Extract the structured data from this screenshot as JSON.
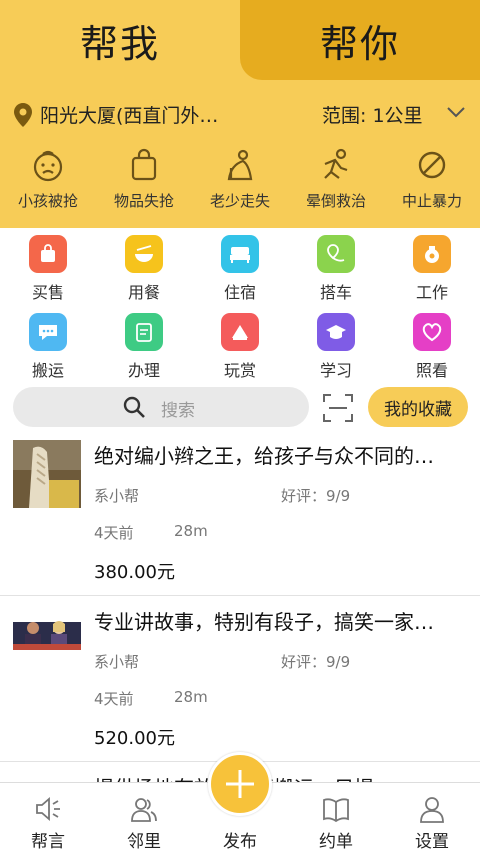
{
  "tabs": {
    "left": "帮我",
    "right": "帮你"
  },
  "location": {
    "address": "阳光大厦(西直门外…",
    "range": "范围: 1公里"
  },
  "quick_actions": [
    {
      "label": "小孩被抢",
      "icon": "baby-face-icon"
    },
    {
      "label": "物品失抢",
      "icon": "bag-icon"
    },
    {
      "label": "老少走失",
      "icon": "walker-icon"
    },
    {
      "label": "晕倒救治",
      "icon": "fainting-person-icon"
    },
    {
      "label": "中止暴力",
      "icon": "no-sign-icon"
    }
  ],
  "categories": [
    {
      "label": "买售",
      "color": "#f4674a",
      "icon": "shopping-bag-icon"
    },
    {
      "label": "用餐",
      "color": "#f6c31c",
      "icon": "meal-bowl-icon"
    },
    {
      "label": "住宿",
      "color": "#33c3e8",
      "icon": "bed-icon"
    },
    {
      "label": "搭车",
      "color": "#8bd34d",
      "icon": "route-pin-icon"
    },
    {
      "label": "工作",
      "color": "#f6a62e",
      "icon": "money-bag-icon"
    },
    {
      "label": "搬运",
      "color": "#4fb8f2",
      "icon": "chat-bubble-icon"
    },
    {
      "label": "办理",
      "color": "#3ecb84",
      "icon": "clipboard-icon"
    },
    {
      "label": "玩赏",
      "color": "#f45b5b",
      "icon": "triangle-icon"
    },
    {
      "label": "学习",
      "color": "#7f5ce6",
      "icon": "graduation-cap-icon"
    },
    {
      "label": "照看",
      "color": "#e53fc6",
      "icon": "heart-icon"
    }
  ],
  "search": {
    "placeholder": "搜索",
    "favorites_label": "我的收藏"
  },
  "items": [
    {
      "title": "绝对编小辫之王，给孩子与众不同的…",
      "author": "系小帮",
      "rating": "好评：9/9",
      "time": "4天前",
      "distance": "28m",
      "price": "380.00元"
    },
    {
      "title": "专业讲故事，特别有段子，搞笑一家…",
      "author": "系小帮",
      "rating": "好评：9/9",
      "time": "4天前",
      "distance": "28m",
      "price": "520.00元"
    },
    {
      "title": "提供场地存放，自行搬运，只提…"
    }
  ],
  "nav": [
    {
      "label": "帮言",
      "icon": "speaker-icon"
    },
    {
      "label": "邻里",
      "icon": "people-icon"
    },
    {
      "label": "发布",
      "icon": "plus-icon"
    },
    {
      "label": "约单",
      "icon": "book-icon"
    },
    {
      "label": "设置",
      "icon": "user-icon"
    }
  ],
  "colors": {
    "primary": "#f7cc57",
    "tab_active_alt": "#e6ac1f"
  }
}
